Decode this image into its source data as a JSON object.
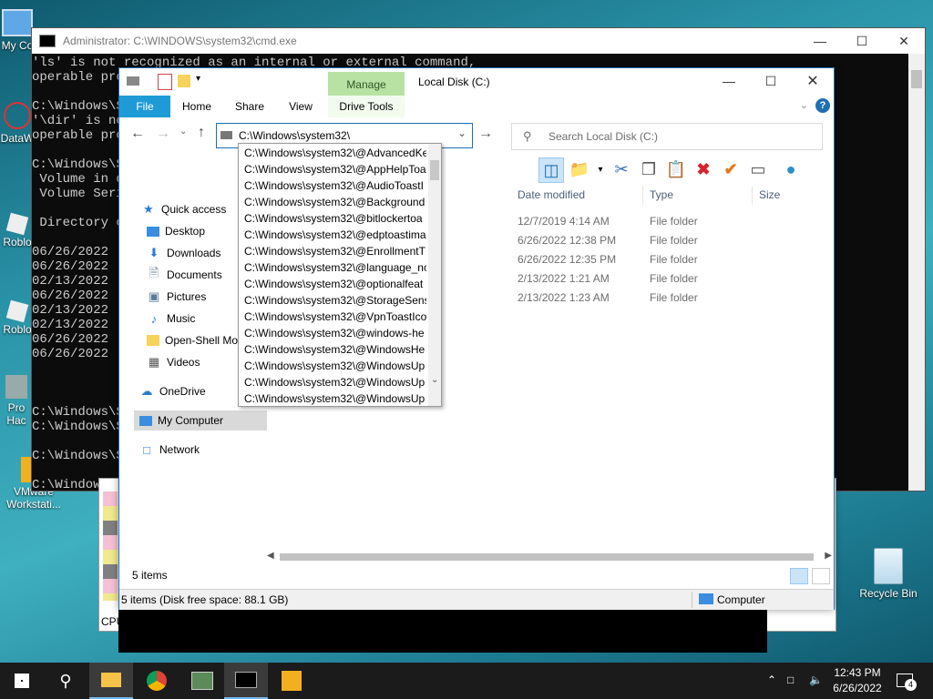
{
  "desktop": {
    "icons": [
      {
        "label": "My Co"
      },
      {
        "label": "DataW"
      },
      {
        "label": "Roblo"
      },
      {
        "label": "Roblo"
      },
      {
        "label": "Pro Hac"
      },
      {
        "label": "VMware Workstati..."
      },
      {
        "label": "Recycle Bin"
      }
    ]
  },
  "cmd": {
    "title": "Administrator: C:\\WINDOWS\\system32\\cmd.exe",
    "lines": [
      "'ls' is not recognized as an internal or external command,",
      "operable pro",
      "",
      "C:\\Windows\\S",
      "'\\dir' is no",
      "operable pro",
      "",
      "C:\\Windows\\S",
      " Volume in d",
      " Volume Seri",
      "",
      " Directory o",
      "",
      "06/26/2022",
      "06/26/2022",
      "02/13/2022",
      "06/26/2022",
      "02/13/2022",
      "02/13/2022",
      "06/26/2022",
      "06/26/2022",
      "",
      "",
      "",
      "C:\\Windows\\S",
      "C:\\Windows\\S",
      "",
      "C:\\Windows\\S",
      "",
      "C:\\Windows\\S"
    ]
  },
  "taskmgr": {
    "cpu_label": "CPU"
  },
  "explorer": {
    "title": "Local Disk (C:)",
    "tabs": {
      "file": "File",
      "home": "Home",
      "share": "Share",
      "view": "View",
      "manage": "Manage",
      "drive_tools": "Drive Tools"
    },
    "address_value": "C:\\Windows\\system32\\",
    "search_placeholder": "Search Local Disk (C:)",
    "nav": {
      "quick_access": "Quick access",
      "desktop": "Desktop",
      "downloads": "Downloads",
      "documents": "Documents",
      "pictures": "Pictures",
      "music": "Music",
      "open_shell": "Open-Shell Mo",
      "videos": "Videos",
      "onedrive": "OneDrive",
      "my_computer": "My Computer",
      "network": "Network"
    },
    "columns": {
      "date": "Date modified",
      "type": "Type",
      "size": "Size"
    },
    "rows": [
      {
        "date": "12/7/2019 4:14 AM",
        "type": "File folder"
      },
      {
        "date": "6/26/2022 12:38 PM",
        "type": "File folder"
      },
      {
        "date": "6/26/2022 12:35 PM",
        "type": "File folder"
      },
      {
        "date": "2/13/2022 1:21 AM",
        "type": "File folder"
      },
      {
        "date": "2/13/2022 1:23 AM",
        "type": "File folder"
      }
    ],
    "item_count": "5 items",
    "status_left": "5 items (Disk free space: 88.1 GB)",
    "status_right": "Computer",
    "autocomplete": [
      "C:\\Windows\\system32\\@AdvancedKe",
      "C:\\Windows\\system32\\@AppHelpToa",
      "C:\\Windows\\system32\\@AudioToastI",
      "C:\\Windows\\system32\\@Background",
      "C:\\Windows\\system32\\@bitlockertoa",
      "C:\\Windows\\system32\\@edptoastima",
      "C:\\Windows\\system32\\@EnrollmentT",
      "C:\\Windows\\system32\\@language_nc",
      "C:\\Windows\\system32\\@optionalfeat",
      "C:\\Windows\\system32\\@StorageSens",
      "C:\\Windows\\system32\\@VpnToastIco",
      "C:\\Windows\\system32\\@windows-he",
      "C:\\Windows\\system32\\@WindowsHe",
      "C:\\Windows\\system32\\@WindowsUp",
      "C:\\Windows\\system32\\@WindowsUp",
      "C:\\Windows\\system32\\@WindowsUp"
    ]
  },
  "taskbar": {
    "time": "12:43 PM",
    "date": "6/26/2022",
    "notifications": "4"
  },
  "colors": {
    "accent": "#1f6fb4",
    "manage_tab": "#b8e2a4",
    "file_tab": "#1e9bd7"
  }
}
